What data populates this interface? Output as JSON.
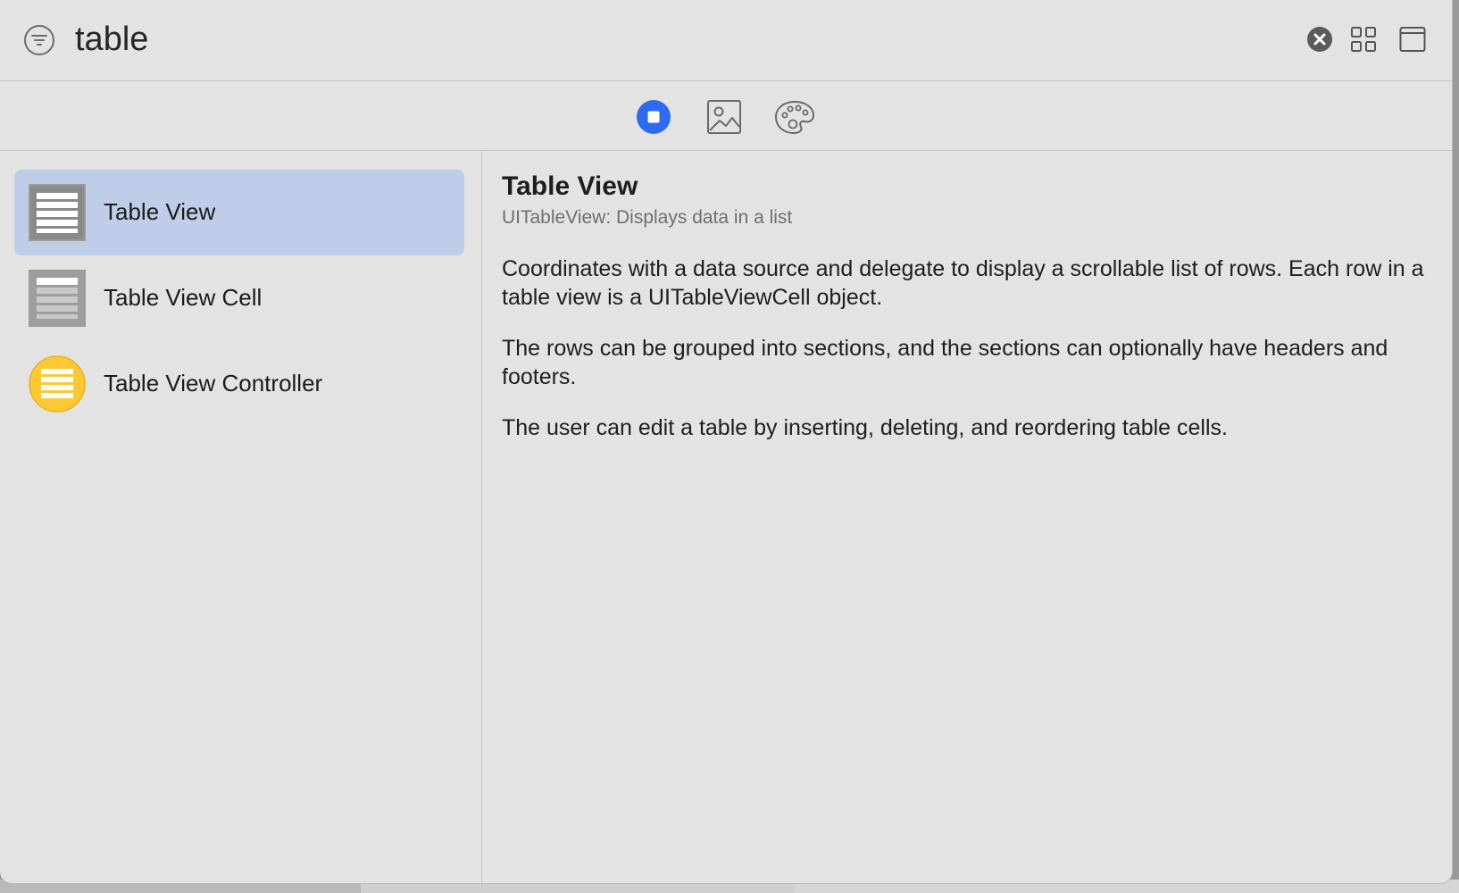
{
  "search": {
    "value": "table"
  },
  "toolbar_icons": {
    "filter": "filter-icon",
    "clear": "clear-icon",
    "grid_view": "grid-icon",
    "panel": "panel-icon"
  },
  "tabs": [
    {
      "icon": "objects-icon",
      "selected": true,
      "accent": "#2f6bf0"
    },
    {
      "icon": "image-icon",
      "selected": false
    },
    {
      "icon": "palette-icon",
      "selected": false
    }
  ],
  "library_items": [
    {
      "label": "Table View",
      "icon": "table-view-icon",
      "selected": true
    },
    {
      "label": "Table View Cell",
      "icon": "table-view-cell-icon",
      "selected": false
    },
    {
      "label": "Table View Controller",
      "icon": "table-view-controller-icon",
      "selected": false,
      "accent": "#fcc935"
    }
  ],
  "detail": {
    "title": "Table View",
    "subtitle": "UITableView: Displays data in a list",
    "paragraphs": [
      "Coordinates with a data source and delegate to display a scrollable list of rows. Each row in a table view is a UITableViewCell object.",
      "The rows can be grouped into sections, and the sections can optionally have headers and footers.",
      "The user can edit a table by inserting, deleting, and reordering table cells."
    ]
  }
}
